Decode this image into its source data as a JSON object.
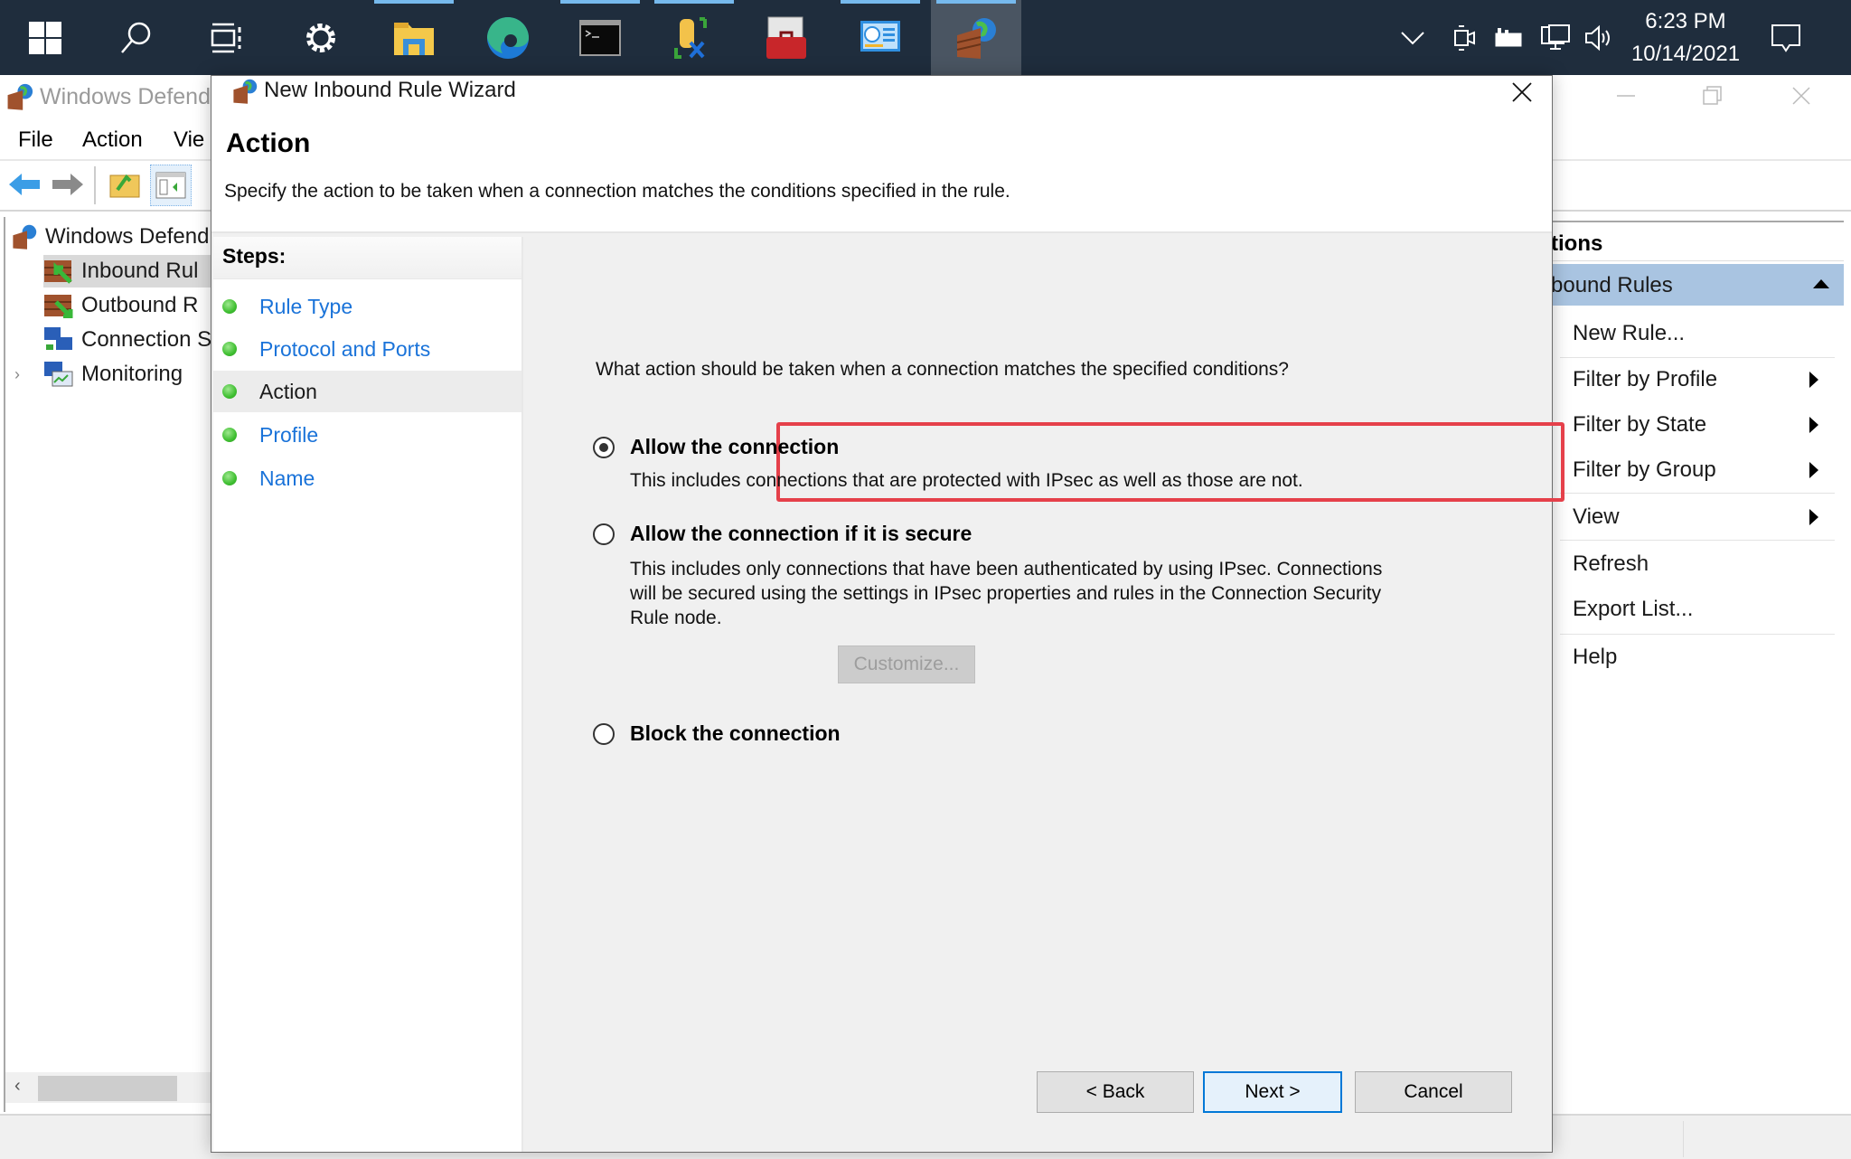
{
  "taskbar": {
    "apps": [
      {
        "name": "start",
        "icon": "windows-logo-icon"
      },
      {
        "name": "search",
        "icon": "search-icon"
      },
      {
        "name": "task-view",
        "icon": "task-view-icon"
      },
      {
        "name": "settings",
        "icon": "gear-icon"
      },
      {
        "name": "file-explorer",
        "icon": "folder-icon",
        "running": true
      },
      {
        "name": "edge",
        "icon": "edge-icon"
      },
      {
        "name": "terminal",
        "icon": "terminal-icon",
        "running": true
      },
      {
        "name": "admin-tool",
        "icon": "tools-icon",
        "running": true
      },
      {
        "name": "toolbox",
        "icon": "toolbox-icon"
      },
      {
        "name": "control-panel",
        "icon": "control-panel-icon",
        "running": true
      },
      {
        "name": "firewall",
        "icon": "firewall-icon",
        "running": true,
        "active": true
      }
    ],
    "tray_icons": [
      "chevron-up-icon",
      "meet-now-icon",
      "battery-icon",
      "network-icon",
      "volume-icon"
    ],
    "time": "6:23 PM",
    "date": "10/14/2021",
    "notification_icon": "action-center-icon"
  },
  "background_window": {
    "title": "Windows Defend",
    "menu": [
      "File",
      "Action",
      "Vie"
    ],
    "tree": [
      {
        "label": "Windows Defend",
        "icon": "firewall-icon",
        "level": 0
      },
      {
        "label": "Inbound Rul",
        "icon": "inbound-rules-icon",
        "level": 1,
        "selected": true
      },
      {
        "label": "Outbound R",
        "icon": "outbound-rules-icon",
        "level": 1
      },
      {
        "label": "Connection S",
        "icon": "connection-security-icon",
        "level": 1
      },
      {
        "label": "Monitoring",
        "icon": "monitoring-icon",
        "level": 1,
        "expandable": true
      }
    ],
    "actions_pane": {
      "header": "tions",
      "section": "bound Rules",
      "items": [
        {
          "label": "New Rule...",
          "submenu": false
        },
        {
          "label": "Filter by Profile",
          "submenu": true
        },
        {
          "label": "Filter by State",
          "submenu": true
        },
        {
          "label": "Filter by Group",
          "submenu": true
        },
        {
          "label": "View",
          "submenu": true
        },
        {
          "label": "Refresh",
          "submenu": false
        },
        {
          "label": "Export List...",
          "submenu": false
        },
        {
          "label": "Help",
          "submenu": false
        }
      ]
    }
  },
  "dialog": {
    "title": "New Inbound Rule Wizard",
    "heading": "Action",
    "subtitle": "Specify the action to be taken when a connection matches the conditions specified in the rule.",
    "steps_title": "Steps:",
    "steps": [
      {
        "label": "Rule Type",
        "current": false
      },
      {
        "label": "Protocol and Ports",
        "current": false
      },
      {
        "label": "Action",
        "current": true
      },
      {
        "label": "Profile",
        "current": false
      },
      {
        "label": "Name",
        "current": false
      }
    ],
    "question": "What action should be taken when a connection matches the specified conditions?",
    "options": [
      {
        "label": "Allow the connection",
        "checked": true,
        "description": [
          "This includes connections that are protected with IPsec as well as those are not."
        ]
      },
      {
        "label": "Allow the connection if it is secure",
        "checked": false,
        "description": [
          "This includes only connections that have been authenticated by using IPsec.  Connections",
          "will be secured using the settings in IPsec properties and rules in the Connection Security",
          "Rule node."
        ]
      },
      {
        "label": "Block the connection",
        "checked": false,
        "description": []
      }
    ],
    "customize_label": "Customize...",
    "buttons": {
      "back": "< Back",
      "next": "Next >",
      "cancel": "Cancel"
    },
    "highlight_color": "#e5404a"
  }
}
